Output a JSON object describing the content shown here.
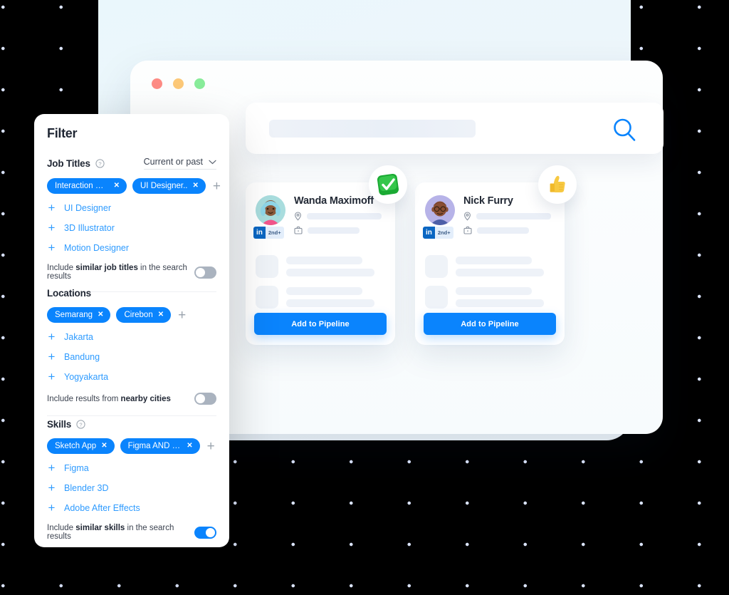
{
  "window": {
    "traffic_lights": [
      "close-red",
      "minimize-yellow",
      "maximize-green"
    ],
    "colors": {
      "red": "#fd8b84",
      "yellow": "#fcc878",
      "green": "#88ec9a"
    }
  },
  "search": {
    "value": "",
    "placeholder": "",
    "icon": "search-icon",
    "icon_color": "#0a84fd"
  },
  "filter": {
    "title": "Filter",
    "sections": [
      {
        "id": "job-titles",
        "title": "Job Titles",
        "help_icon": "question-circle-icon",
        "dropdown": {
          "label": "Current or past",
          "icon": "chevron-down-icon"
        },
        "chips": [
          {
            "label": "Interaction Des...",
            "remove": "✕"
          },
          {
            "label": "UI Designer..",
            "remove": "✕"
          }
        ],
        "add_label": "+",
        "suggestions": [
          {
            "plus": "+",
            "label": "UI Designer"
          },
          {
            "plus": "+",
            "label": "3D Illustrator"
          },
          {
            "plus": "+",
            "label": "Motion Designer"
          }
        ],
        "toggle": {
          "prefix": "Include ",
          "bold": "similar job titles",
          "suffix": " in the search results",
          "state": "off"
        }
      },
      {
        "id": "locations",
        "title": "Locations",
        "help_icon": "",
        "dropdown": null,
        "chips": [
          {
            "label": "Semarang",
            "remove": "✕"
          },
          {
            "label": "Cirebon",
            "remove": "✕"
          }
        ],
        "add_label": "+",
        "suggestions": [
          {
            "plus": "+",
            "label": "Jakarta"
          },
          {
            "plus": "+",
            "label": "Bandung"
          },
          {
            "plus": "+",
            "label": "Yogyakarta"
          }
        ],
        "toggle": {
          "prefix": "Include results from ",
          "bold": "nearby cities",
          "suffix": "",
          "state": "off"
        }
      },
      {
        "id": "skills",
        "title": "Skills",
        "help_icon": "question-circle-icon",
        "dropdown": null,
        "chips": [
          {
            "label": "Sketch App",
            "remove": "✕"
          },
          {
            "label": "Figma AND Cine..",
            "remove": "✕"
          }
        ],
        "add_label": "+",
        "suggestions": [
          {
            "plus": "+",
            "label": "Figma"
          },
          {
            "plus": "+",
            "label": "Blender 3D"
          },
          {
            "plus": "+",
            "label": "Adobe After Effects"
          }
        ],
        "toggle": {
          "prefix": "Include ",
          "bold": "similar skills",
          "suffix": " in the search results",
          "state": "on"
        }
      }
    ]
  },
  "candidates": [
    {
      "name": "Wanda Maximoff",
      "avatar": "avatar-wanda",
      "linkedin": {
        "logo": "in",
        "degree": "2nd+"
      },
      "location_icon": "location-pin-icon",
      "company_icon": "briefcase-icon",
      "button_label": "Add to Pipeline",
      "badge": "green-check-badge"
    },
    {
      "name": "Nick Furry",
      "avatar": "avatar-nick",
      "linkedin": {
        "logo": "in",
        "degree": "2nd+"
      },
      "location_icon": "location-pin-icon",
      "company_icon": "briefcase-icon",
      "button_label": "Add to Pipeline",
      "badge": "thumbs-up-badge"
    }
  ],
  "accent_color": "#0a84fd"
}
